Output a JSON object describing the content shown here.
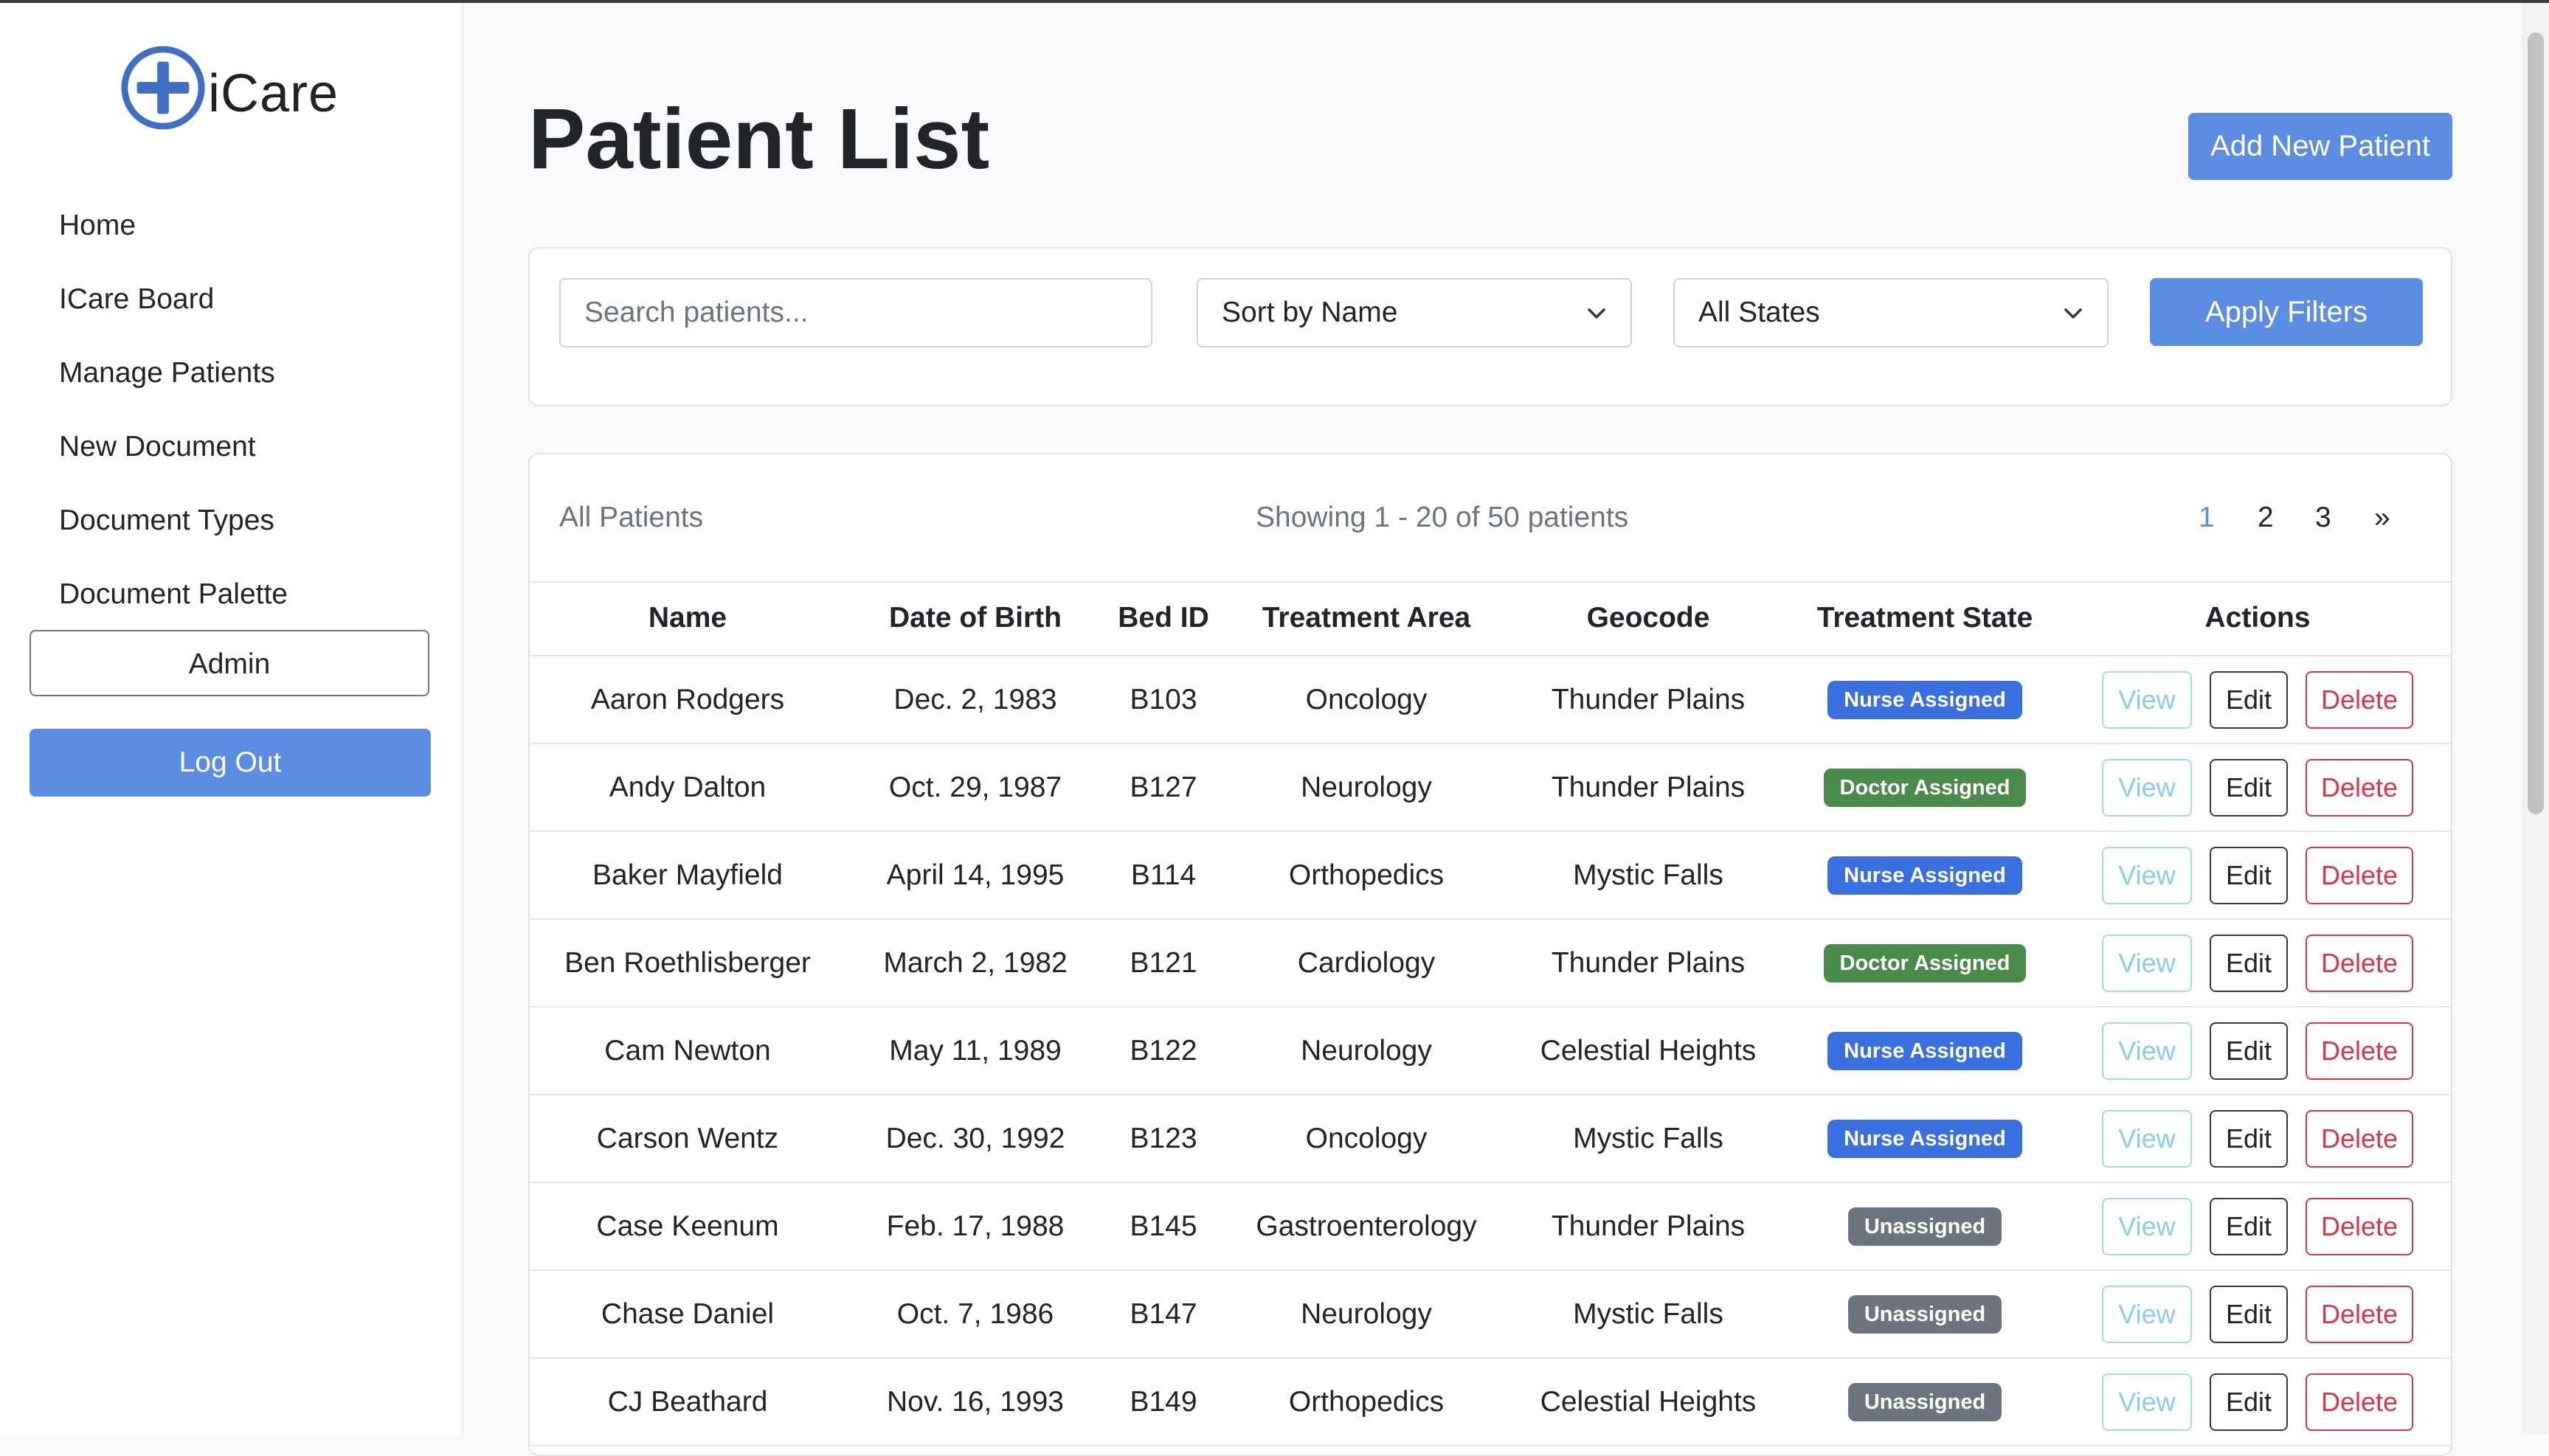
{
  "app": {
    "name": "iCare"
  },
  "sidebar": {
    "items": [
      {
        "label": "Home"
      },
      {
        "label": "ICare Board"
      },
      {
        "label": "Manage Patients"
      },
      {
        "label": "New Document"
      },
      {
        "label": "Document Types"
      },
      {
        "label": "Document Palette"
      }
    ],
    "admin_label": "Admin",
    "logout_label": "Log Out"
  },
  "page": {
    "title": "Patient List",
    "add_button": "Add New Patient"
  },
  "filters": {
    "search_placeholder": "Search patients...",
    "sort_value": "Sort by Name",
    "state_value": "All States",
    "apply_label": "Apply Filters"
  },
  "list": {
    "heading": "All Patients",
    "showing": "Showing 1 - 20 of 50 patients",
    "pages": [
      "1",
      "2",
      "3",
      "»"
    ],
    "current_page": "1",
    "columns": [
      "Name",
      "Date of Birth",
      "Bed ID",
      "Treatment Area",
      "Geocode",
      "Treatment State",
      "Actions"
    ],
    "action_labels": {
      "view": "View",
      "edit": "Edit",
      "delete": "Delete"
    },
    "rows": [
      {
        "name": "Aaron Rodgers",
        "dob": "Dec. 2, 1983",
        "bed": "B103",
        "area": "Oncology",
        "geo": "Thunder Plains",
        "state": "Nurse Assigned"
      },
      {
        "name": "Andy Dalton",
        "dob": "Oct. 29, 1987",
        "bed": "B127",
        "area": "Neurology",
        "geo": "Thunder Plains",
        "state": "Doctor Assigned"
      },
      {
        "name": "Baker Mayfield",
        "dob": "April 14, 1995",
        "bed": "B114",
        "area": "Orthopedics",
        "geo": "Mystic Falls",
        "state": "Nurse Assigned"
      },
      {
        "name": "Ben Roethlisberger",
        "dob": "March 2, 1982",
        "bed": "B121",
        "area": "Cardiology",
        "geo": "Thunder Plains",
        "state": "Doctor Assigned"
      },
      {
        "name": "Cam Newton",
        "dob": "May 11, 1989",
        "bed": "B122",
        "area": "Neurology",
        "geo": "Celestial Heights",
        "state": "Nurse Assigned"
      },
      {
        "name": "Carson Wentz",
        "dob": "Dec. 30, 1992",
        "bed": "B123",
        "area": "Oncology",
        "geo": "Mystic Falls",
        "state": "Nurse Assigned"
      },
      {
        "name": "Case Keenum",
        "dob": "Feb. 17, 1988",
        "bed": "B145",
        "area": "Gastroenterology",
        "geo": "Thunder Plains",
        "state": "Unassigned"
      },
      {
        "name": "Chase Daniel",
        "dob": "Oct. 7, 1986",
        "bed": "B147",
        "area": "Neurology",
        "geo": "Mystic Falls",
        "state": "Unassigned"
      },
      {
        "name": "CJ Beathard",
        "dob": "Nov. 16, 1993",
        "bed": "B149",
        "area": "Orthopedics",
        "geo": "Celestial Heights",
        "state": "Unassigned"
      }
    ]
  },
  "colors": {
    "primary": "#5b8de2",
    "nurse_assigned": "#3a6fe0",
    "doctor_assigned": "#4a8a4a",
    "unassigned": "#6c757d",
    "view": "#86cfe6",
    "delete": "#dc3545"
  },
  "icons": {
    "logo": "plus-circle-icon",
    "dropdown": "chevron-down-icon"
  }
}
